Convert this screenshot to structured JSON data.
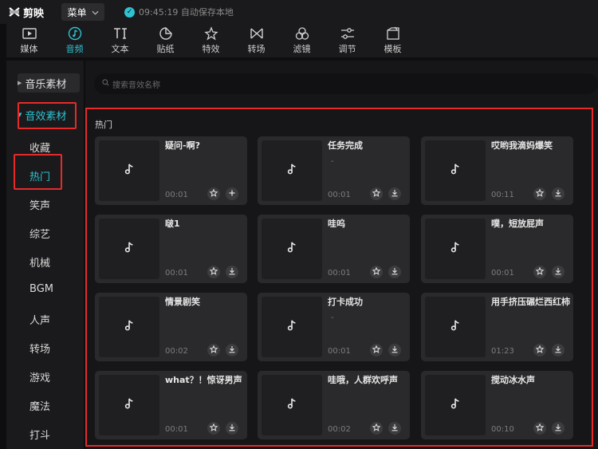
{
  "app": {
    "name": "剪映"
  },
  "titlebar": {
    "menu_label": "菜单",
    "save_status": "09:45:19 自动保存本地"
  },
  "toolbar": [
    {
      "label": "媒体",
      "icon": "media-icon"
    },
    {
      "label": "音频",
      "icon": "audio-icon",
      "active": true
    },
    {
      "label": "文本",
      "icon": "text-icon"
    },
    {
      "label": "贴纸",
      "icon": "sticker-icon"
    },
    {
      "label": "特效",
      "icon": "effects-icon"
    },
    {
      "label": "转场",
      "icon": "transition-icon"
    },
    {
      "label": "滤镜",
      "icon": "filter-icon"
    },
    {
      "label": "调节",
      "icon": "adjust-icon"
    },
    {
      "label": "模板",
      "icon": "template-icon"
    }
  ],
  "sidebar": {
    "music_category": "音乐素材",
    "sfx_category": "音效素材",
    "sub_items": [
      "收藏",
      "热门",
      "笑声",
      "综艺",
      "机械",
      "BGM",
      "人声",
      "转场",
      "游戏",
      "魔法",
      "打斗"
    ],
    "active_sub": "热门"
  },
  "search": {
    "placeholder": "搜索音效名称"
  },
  "section": {
    "title": "热门"
  },
  "cards": [
    {
      "name": "疑问-啊?",
      "sub": "",
      "duration": "00:01",
      "action": "add"
    },
    {
      "name": "任务完成",
      "sub": "-",
      "duration": "00:01",
      "action": "download"
    },
    {
      "name": "哎哟我滴妈爆笑",
      "sub": "",
      "duration": "00:11",
      "action": "download"
    },
    {
      "name": "啵1",
      "sub": "",
      "duration": "00:01",
      "action": "download"
    },
    {
      "name": "哇呜",
      "sub": "",
      "duration": "00:01",
      "action": "download"
    },
    {
      "name": "噗，短放屁声",
      "sub": "",
      "duration": "00:01",
      "action": "download"
    },
    {
      "name": "情景剧笑",
      "sub": "",
      "duration": "00:02",
      "action": "download"
    },
    {
      "name": "打卡成功",
      "sub": "-",
      "duration": "00:01",
      "action": "download"
    },
    {
      "name": "用手挤压碾烂西红柿",
      "sub": "",
      "duration": "01:23",
      "action": "download"
    },
    {
      "name": "what？！惊讶男声",
      "sub": "",
      "duration": "00:01",
      "action": "download"
    },
    {
      "name": "哇哦，人群欢呼声",
      "sub": "",
      "duration": "00:02",
      "action": "download"
    },
    {
      "name": "搅动冰水声",
      "sub": "",
      "duration": "00:10",
      "action": "download"
    }
  ],
  "colors": {
    "accent": "#2dc3d3",
    "highlight": "#e62a2a"
  }
}
